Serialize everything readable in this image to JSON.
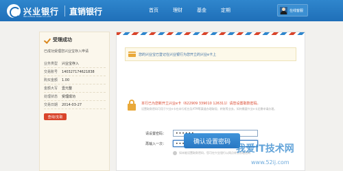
{
  "header": {
    "brand_name": "兴业银行",
    "brand_sub": "INDUSTRIAL BANK CO.,LTD.",
    "product_name": "直销银行",
    "nav": [
      "首页",
      "理财",
      "基金",
      "定期"
    ],
    "service_label": "在线客服"
  },
  "status": {
    "title": "受理成功",
    "description": "已成功受理您兴业宝存入申请",
    "details": [
      {
        "key": "业务类型",
        "value": "兴业宝存入"
      },
      {
        "key": "交易账号",
        "value": "140327174621838"
      },
      {
        "key": "购买金额",
        "value": "1.00"
      },
      {
        "key": "金额大写",
        "value": "壹元整"
      },
      {
        "key": "处理状态",
        "value": "受理成功"
      },
      {
        "key": "交易日期",
        "value": "2014-03-27"
      }
    ],
    "query_button": "查询/支取"
  },
  "main": {
    "notice": "您的兴业宝已登记在兴业银行为您开立的兴业e卡上",
    "hint_main": "本行已为您新开立兴业e卡（622909 339010 126311）请您设置取款密码。",
    "hint_sub": "设置取款密码可用于兴业e卡在本行柜台及ATM等渠道办理取现、转账等业务，如何需要兴业e卡还需申请办理。",
    "password_label": "请设置密码：",
    "password_value": "••••••",
    "confirm_label": "再输入一次：",
    "confirm_value": "••••••",
    "warning": "如未能设置取款密码，您可在兴业银行以网点补办办理密码",
    "confirm_button": "确认设置密码"
  },
  "watermark": {
    "main": "我爱IT技术网",
    "url": "www.52ij.com"
  }
}
